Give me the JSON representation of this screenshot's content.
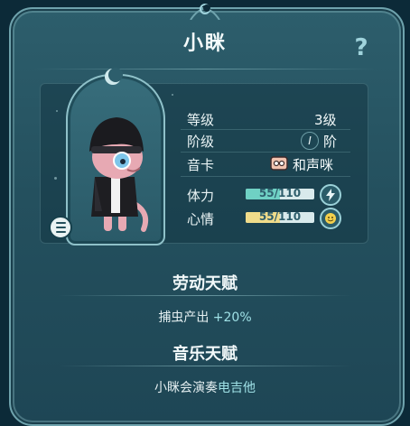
{
  "header": {
    "title": "小眯",
    "help_label": "?"
  },
  "stats": {
    "level_label": "等级",
    "level_value": "3级",
    "stage_label": "阶级",
    "stage_icon_text": "I",
    "stage_value": "阶",
    "card_label": "音卡",
    "card_value": "和声咪",
    "card_icon": "music-cassette-icon",
    "stamina_label": "体力",
    "stamina_text": "55/110",
    "stamina_fraction": 0.5,
    "stamina_icon": "lightning-icon",
    "mood_label": "心情",
    "mood_text": "55/110",
    "mood_fraction": 0.5,
    "mood_icon": "smiley-icon"
  },
  "labor": {
    "title": "劳动天赋",
    "text": "捕虫产出 ",
    "value": "+20%"
  },
  "music": {
    "title": "音乐天赋",
    "text": "小眯会演奏",
    "instrument": "电吉他"
  },
  "colors": {
    "accent": "#9fe1e6",
    "stamina_bar": "#6fd1c4",
    "mood_bar": "#f0dc8a"
  }
}
